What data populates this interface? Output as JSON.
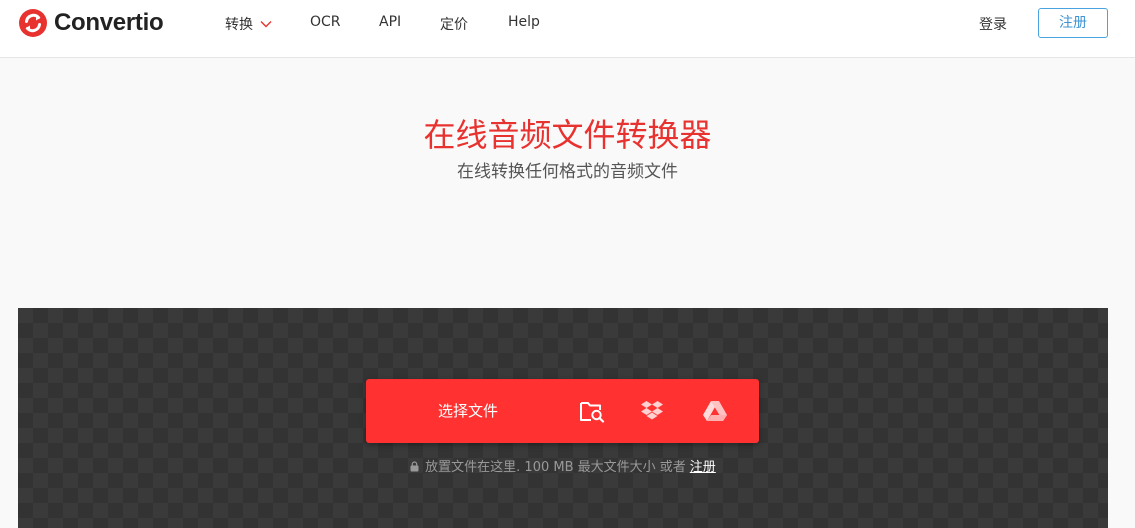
{
  "header": {
    "logo_text": "Convertio",
    "nav": {
      "convert": "转换",
      "ocr": "OCR",
      "api": "API",
      "pricing": "定价",
      "help": "Help"
    },
    "login": "登录",
    "signup": "注册"
  },
  "hero": {
    "title": "在线音频文件转换器",
    "subtitle": "在线转换任何格式的音频文件"
  },
  "upload": {
    "choose_label": "选择文件",
    "sources": [
      "folder-search-icon",
      "dropbox-icon",
      "google-drive-icon"
    ],
    "hint_text": "放置文件在这里. 100 MB 最大文件大小 或者",
    "hint_link": "注册"
  },
  "colors": {
    "accent": "#ff3131",
    "title_red": "#e8322f",
    "signup_blue": "#4aa3df",
    "dropzone_bg": "#3a3a3a"
  }
}
